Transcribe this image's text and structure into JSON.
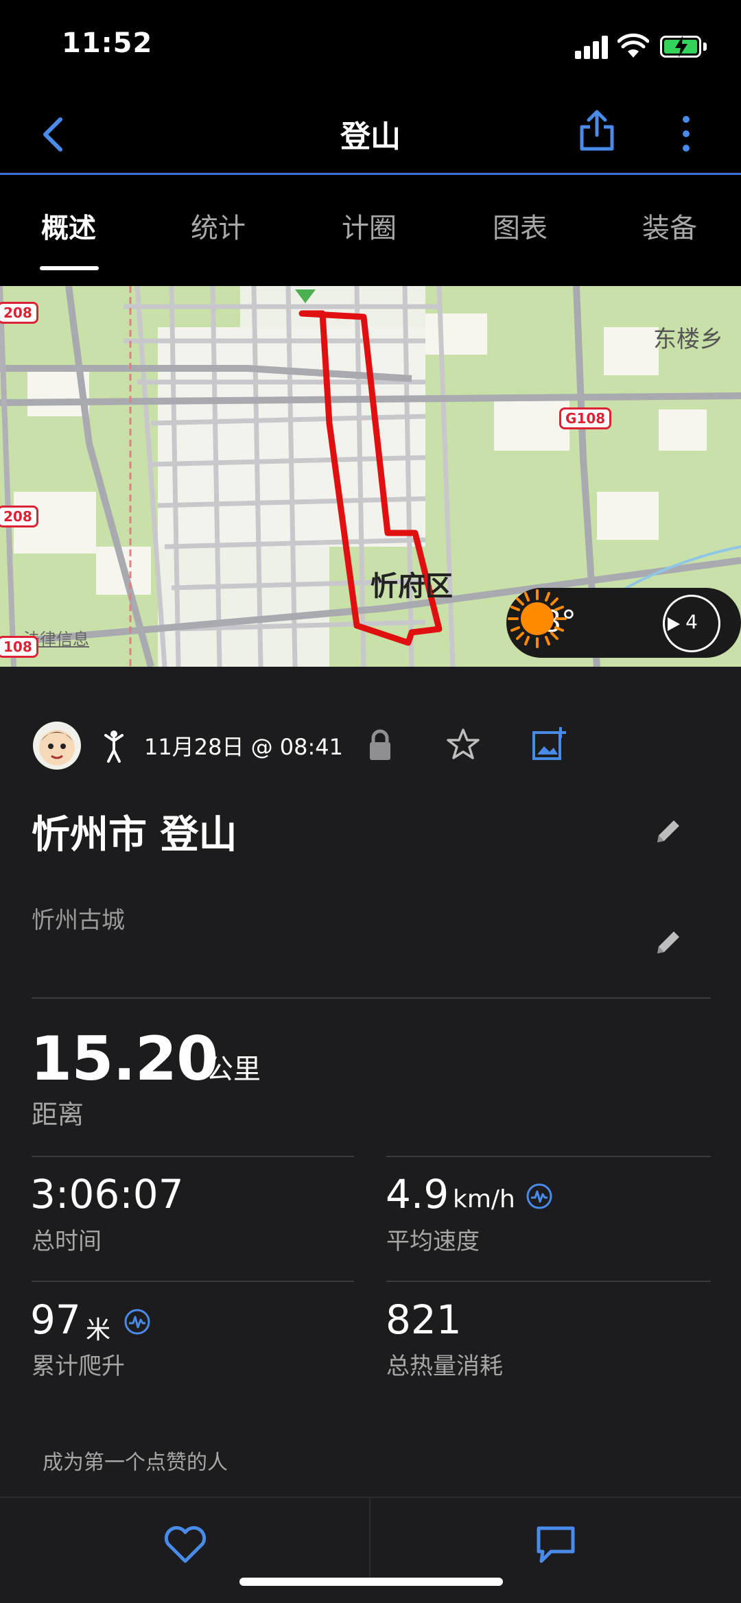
{
  "status_bar": {
    "time": "11:52"
  },
  "nav": {
    "title": "登山"
  },
  "tabs": [
    {
      "label": "概述",
      "active": true
    },
    {
      "label": "统计",
      "active": false
    },
    {
      "label": "计圈",
      "active": false
    },
    {
      "label": "图表",
      "active": false
    },
    {
      "label": "装备",
      "active": false
    }
  ],
  "map": {
    "labels": {
      "east_town": "东楼乡",
      "district": "忻府区",
      "legal": "法律信息"
    },
    "road_badges": [
      "G108",
      "208",
      "208",
      "108"
    ],
    "weather": {
      "temperature": "-8°",
      "wind_speed": "4"
    }
  },
  "activity": {
    "date_time": "11月28日 @ 08:41",
    "title": "忻州市 登山",
    "location": "忻州古城",
    "distance": {
      "value": "15.20",
      "unit": "公里",
      "label": "距离"
    },
    "stats": {
      "total_time": {
        "value": "3:06:07",
        "label": "总时间"
      },
      "avg_speed": {
        "value": "4.9",
        "unit": "km/h",
        "label": "平均速度"
      },
      "ascent": {
        "value": "97",
        "unit": "米",
        "label": "累计爬升"
      },
      "calories": {
        "value": "821",
        "label": "总热量消耗"
      }
    },
    "likes_text": "成为第一个点赞的人"
  },
  "colors": {
    "accent": "#3b82f6",
    "route": "#e01010",
    "background": "#1c1c1e"
  }
}
